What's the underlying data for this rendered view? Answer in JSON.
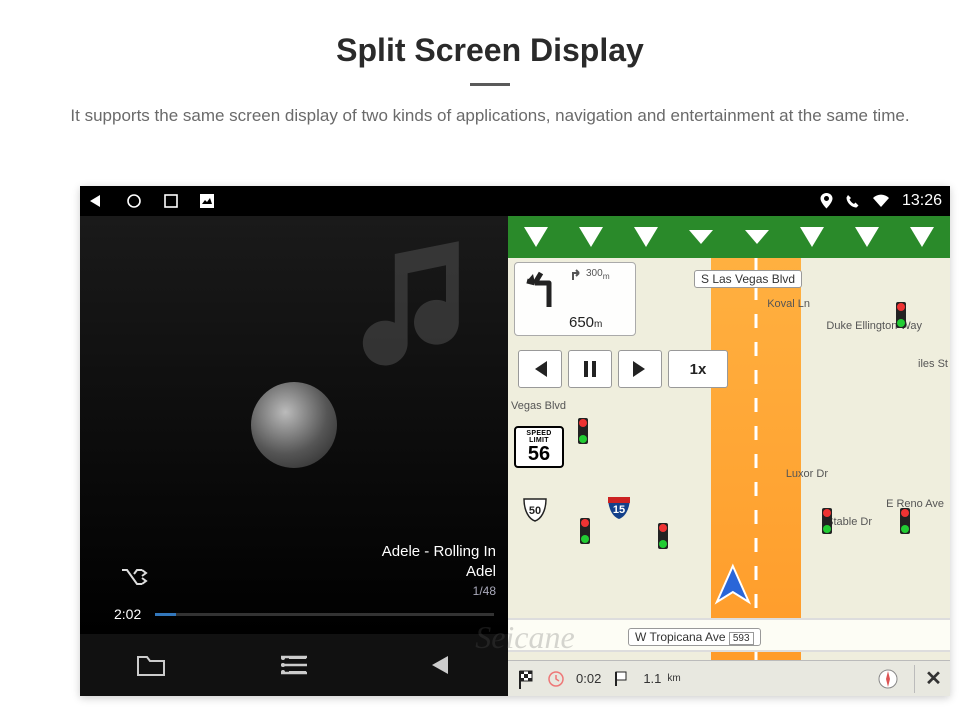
{
  "page": {
    "title": "Split Screen Display",
    "description": "It supports the same screen display of two kinds of applications, navigation and entertainment at the same time."
  },
  "status": {
    "time": "13:26",
    "icons": [
      "location",
      "phone",
      "wifi"
    ]
  },
  "player": {
    "song_line1": "Adele - Rolling In",
    "song_line2": "Adel",
    "track_index": "1/48",
    "elapsed": "2:02",
    "shuffle_icon": "shuffle",
    "bottom": [
      "folder",
      "list",
      "prev"
    ]
  },
  "nav": {
    "turn": {
      "upcoming_dist": "300",
      "upcoming_unit": "m",
      "next_dist": "650",
      "next_unit": "m"
    },
    "controls": {
      "prev": "prev",
      "pause": "pause",
      "next": "next",
      "speed": "1x"
    },
    "speed_limit": {
      "caption": "SPEED LIMIT",
      "value": "56"
    },
    "streets": {
      "top": "S Las Vegas Blvd",
      "bottom": "W Tropicana Ave",
      "bottom_num": "593"
    },
    "labels": {
      "vegas_blvd": "Vegas Blvd",
      "koval": "Koval Ln",
      "ellington": "Duke Ellington Way",
      "luxor": "Luxor Dr",
      "reno": "E Reno Ave",
      "stable": "Stable Dr",
      "iles": "iles St"
    },
    "routes": {
      "i15": "15",
      "us": "50"
    },
    "bottom": {
      "eta": "0:02",
      "dist": "1.1",
      "dist_unit": "km"
    }
  },
  "watermark": "Seicane"
}
